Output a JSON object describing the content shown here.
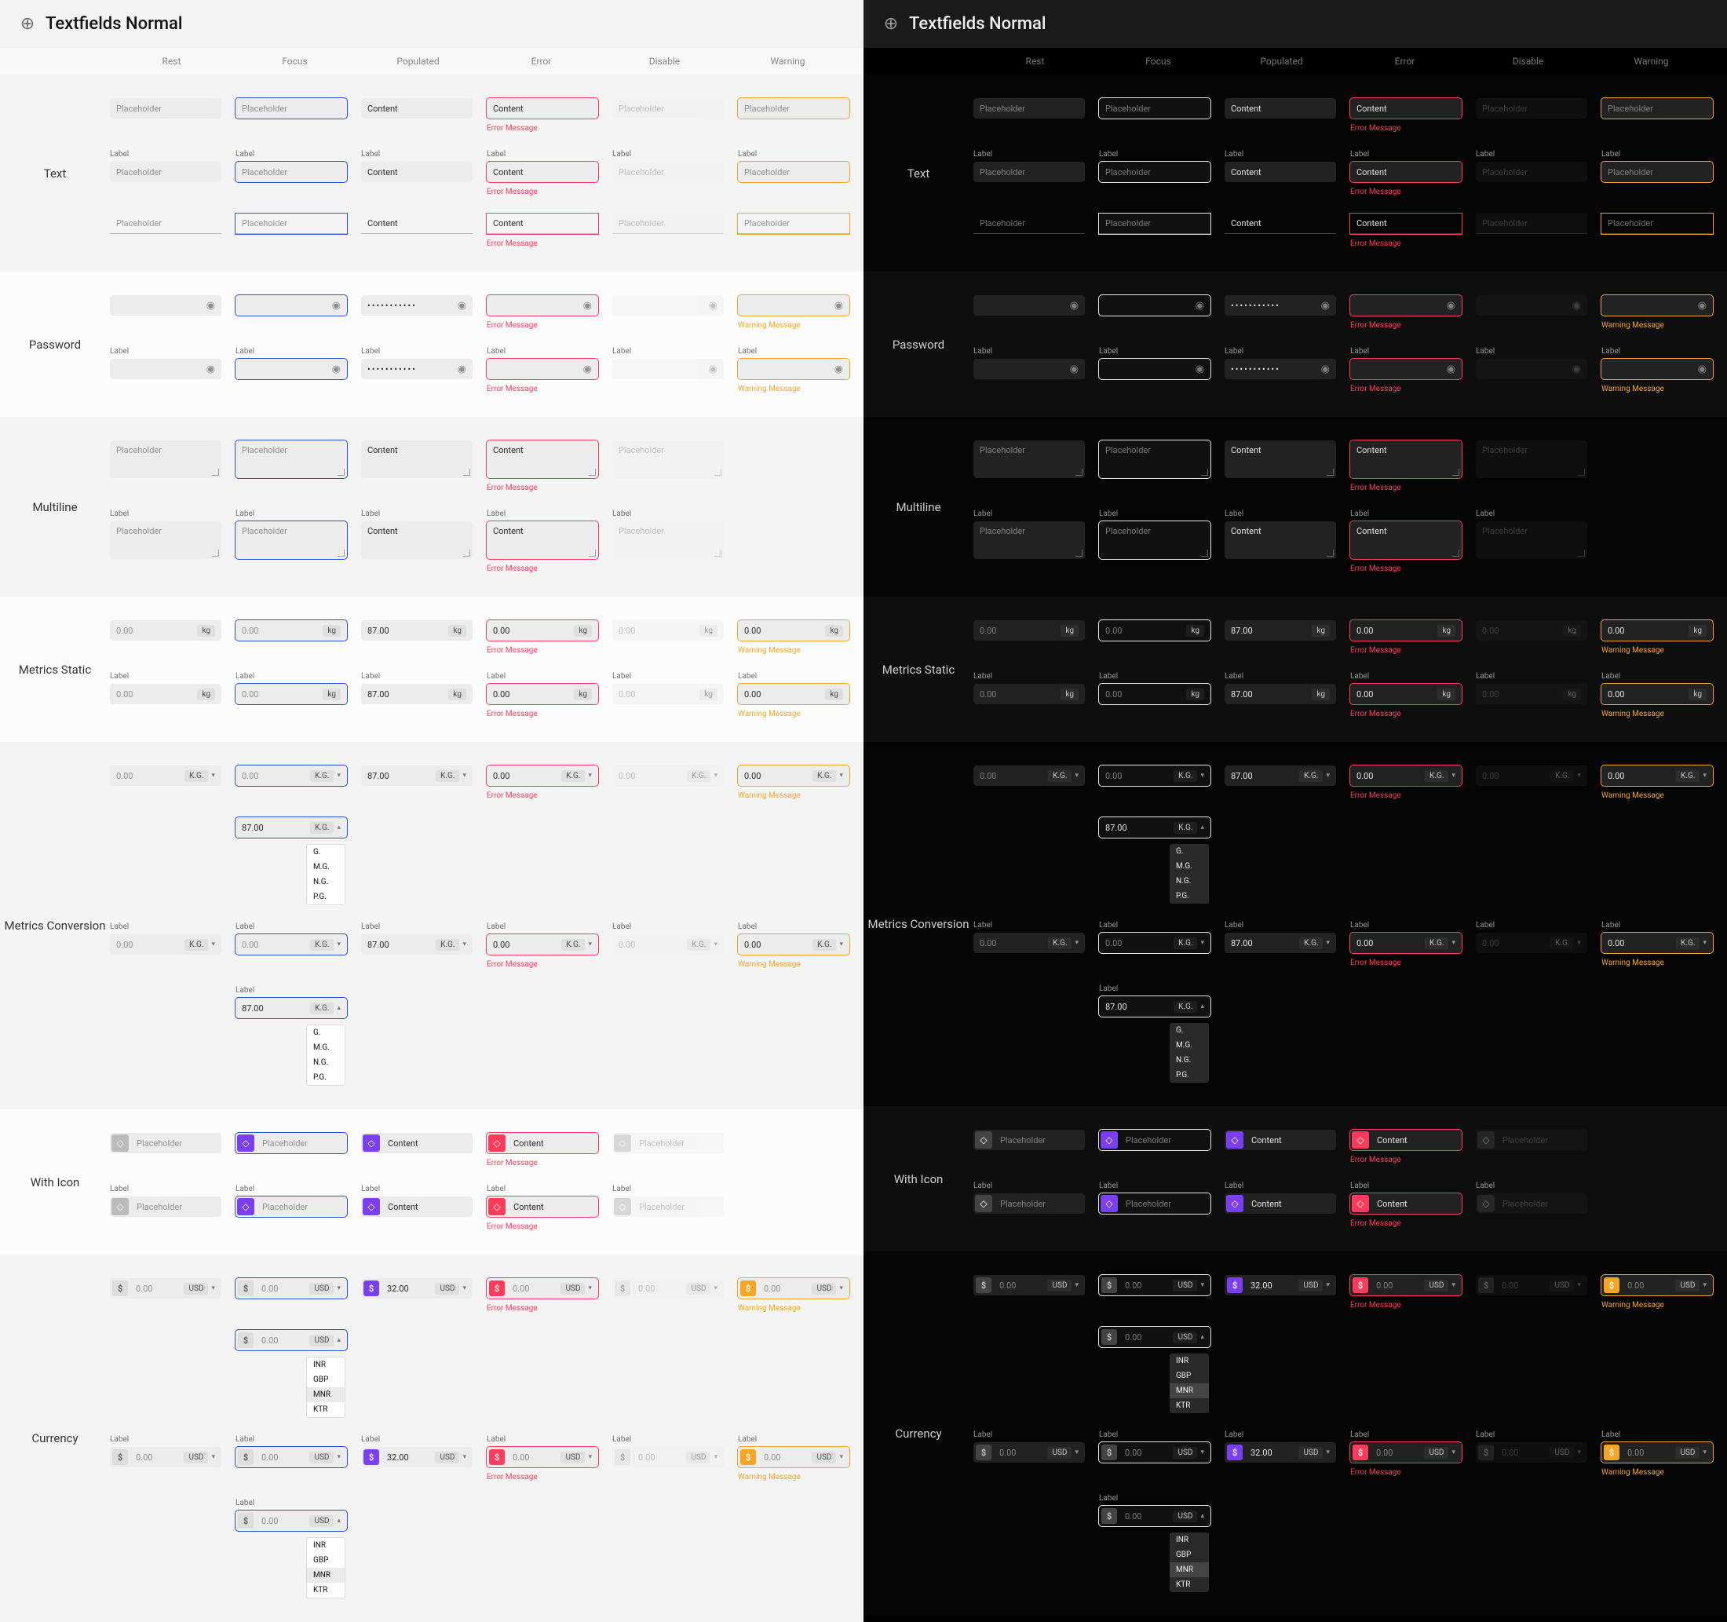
{
  "title": "Textfields Normal",
  "state_labels": [
    "Rest",
    "Focus",
    "Populated",
    "Error",
    "Disable",
    "Warning"
  ],
  "sections": [
    "Text",
    "Password",
    "Multiline",
    "Metrics Static",
    "Metrics Conversion",
    "With Icon",
    "Currency"
  ],
  "strings": {
    "placeholder": "Placeholder",
    "content": "Content",
    "label": "Label",
    "error": "Error Message",
    "warning": "Warning Message",
    "dots": "•••••••••••",
    "zero": "0.00",
    "populated_num": "87.00",
    "kg": "kg",
    "kg_sel": "K.G.",
    "usd": "USD",
    "amount": "32.00",
    "dollar": "$",
    "eye": "◉",
    "icon": "◇",
    "caret_down": "▾",
    "caret_up": "▴"
  },
  "metric_options": [
    "G.",
    "M.G.",
    "N.G.",
    "P.G."
  ],
  "currency_options": [
    "INR",
    "GBP",
    "MNR",
    "KTR"
  ]
}
